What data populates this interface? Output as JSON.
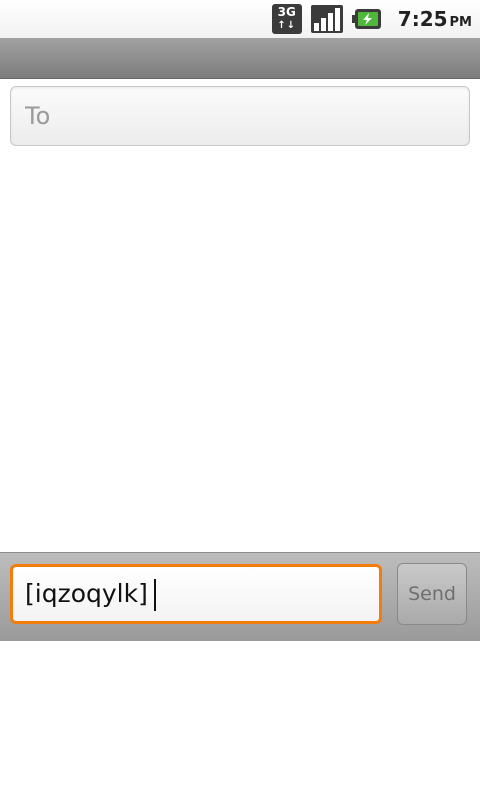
{
  "status_bar": {
    "network_type": "3G",
    "network_icon": "3g-data-icon",
    "signal_icon": "signal-strength-icon",
    "battery_icon": "battery-charging-icon",
    "time": "7:25",
    "ampm": "PM"
  },
  "recipients": {
    "placeholder": "To",
    "value": ""
  },
  "compose": {
    "message": "[iqzoqylk]",
    "send_label": "Send",
    "accent_color": "#f27d0c"
  }
}
